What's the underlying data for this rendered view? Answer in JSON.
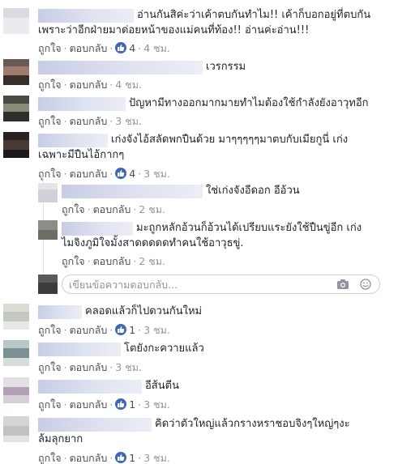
{
  "actions": {
    "like": "ถูกใจ",
    "reply": "ตอบกลับ",
    "separator": "·"
  },
  "comments": [
    {
      "text_lines": [
        "อ่านกันสิค่ะว่าเค้าตบกันทำไม!! เค้าก็บอกอยู่ที่ตบกัน",
        "เพราะว่าอีกฝ่ายมาด่อยหน้าของแม่คนที่ท้อง!! อ่านค่ะอ่าน!!!"
      ],
      "likes": "4",
      "time": "4 ชม."
    },
    {
      "text_lines": [
        "เวรกรรม"
      ],
      "likes": "",
      "time": "4 ชม."
    },
    {
      "text_lines": [
        "ปัญหามีทางออกมากมายทำไมต้องใช้กำลังยังอาวุทอีก"
      ],
      "likes": "",
      "time": "3 ชม."
    },
    {
      "text_lines": [
        "เก่งจังไอ้สลัดพกปืนด้วย มาๆๆๆๆๆมาตบกับเมียกูนี่ เก่ง",
        "เฉพาะมีปืนไอ้กากๆ"
      ],
      "likes": "4",
      "time": "3 ชม."
    },
    {
      "text_lines": [
        "คลอดแล้วก็ไปดวนกันใหม่"
      ],
      "likes": "1",
      "time": "3 ชม."
    },
    {
      "text_lines": [
        "โตยังกะควายแล้ว"
      ],
      "likes": "",
      "time": "3 ชม."
    },
    {
      "text_lines": [
        "อีส้นตีน"
      ],
      "likes": "1",
      "time": "3 ชม."
    },
    {
      "text_lines": [
        "คิดว่าตัวใหญ่แล้วกรางหราชอบจิงๆใหญ่ๆงะ",
        "ล้มลุกยาก"
      ],
      "likes": "1",
      "time": "3 ชม."
    }
  ],
  "replies": [
    {
      "text_lines": [
        "ใช่เก่งจังอีดอก อีอ้วน"
      ],
      "likes": "",
      "time": "2 ชม."
    },
    {
      "text_lines": [
        "มะถูกหลักอ้วนก็อ้วนได้เปรียบแระยังใช้ปืนขู่อีก เก่ง",
        "ไมจิงภูมิใจมั้งสาดดดดดทำคนใช้อาวุธขู่."
      ],
      "likes": "",
      "time": "2 ชม."
    }
  ],
  "reply_box": {
    "placeholder": "เขียนข้อความตอบกลับ..."
  },
  "icons": {
    "like_badge": "like-thumb-icon",
    "camera": "camera-icon",
    "emoji": "emoji-icon"
  },
  "colors": {
    "like_blue": "#4267b2",
    "meta_gray": "#90949c",
    "link_gray": "#4b4f56",
    "text": "#1d2129"
  }
}
